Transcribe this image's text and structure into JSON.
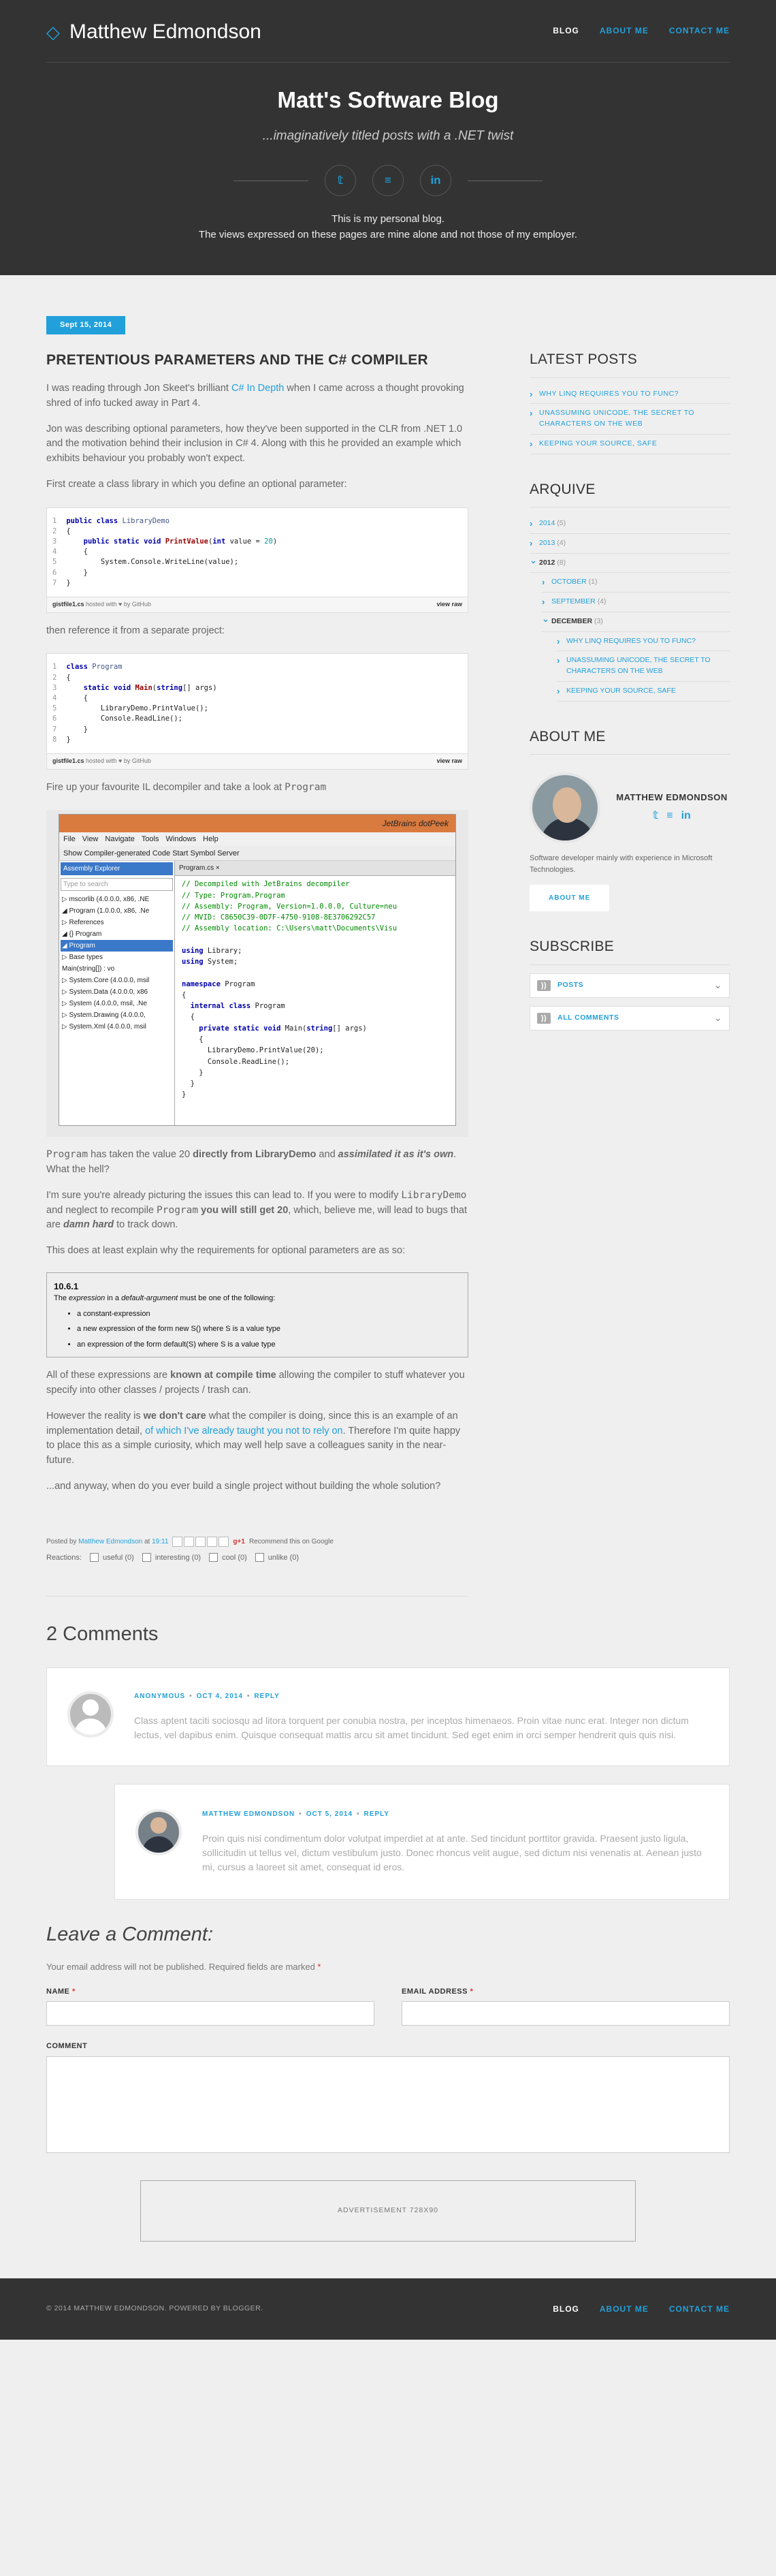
{
  "site": {
    "name": "Matthew Edmondson",
    "nav": [
      {
        "label": "BLOG",
        "active": true
      },
      {
        "label": "ABOUT ME",
        "active": false
      },
      {
        "label": "CONTACT ME",
        "active": false
      }
    ],
    "blog_title_prefix": "Matt's ",
    "blog_title_bold": "Software Blog",
    "tagline": "...imaginatively titled posts with a .NET twist",
    "socials": [
      "twitter",
      "stackoverflow",
      "linkedin"
    ],
    "note_line1": "This is my personal blog.",
    "note_line2": "The views expressed on these pages are mine alone and not those of my employer."
  },
  "post": {
    "date": "Sept 15, 2014",
    "title": "PRETENTIOUS PARAMETERS AND THE C# COMPILER",
    "p1_a": "I was reading through Jon Skeet's brilliant ",
    "p1_link": "C# In Depth",
    "p1_b": " when I came across a thought provoking shred of info tucked away in Part 4.",
    "p2": "Jon was describing optional parameters, how they've been supported in the CLR from .NET 1.0 and the motivation behind their inclusion in C# 4. Along with this he provided an example which exhibits behaviour you probably won't expect.",
    "p3": "First create a class library in which you define an optional parameter:",
    "gist1": {
      "lines": [
        "1",
        "2",
        "3",
        "4",
        "5",
        "6",
        "7"
      ],
      "file": "gistfile1.cs",
      "hosted": " hosted with ♥ by ",
      "host": "GitHub",
      "raw": "view raw"
    },
    "p4": "then reference it from a separate project:",
    "gist2": {
      "lines": [
        "1",
        "2",
        "3",
        "4",
        "5",
        "6",
        "7",
        "8"
      ],
      "file": "gistfile1.cs",
      "hosted": " hosted with ♥ by ",
      "host": "GitHub",
      "raw": "view raw"
    },
    "p5_a": "Fire up your favourite IL decompiler and take a look at ",
    "p5_code": "Program",
    "ide": {
      "title": "JetBrains dotPeek",
      "menu": [
        "File",
        "View",
        "Navigate",
        "Tools",
        "Windows",
        "Help"
      ],
      "toolbar": "Show Compiler-generated Code   Start Symbol Server",
      "tree_header": "Assembly Explorer",
      "tree_search": "Type to search",
      "tree": [
        "▷ mscorlib (4.0.0.0, x86, .NE",
        "◢ Program (1.0.0.0, x86, .Ne",
        "  ▷ References",
        "  ◢ {} Program",
        "    ◢ Program",
        "      ▷ Base types",
        "        Main(string[]) : vo",
        "▷ System.Core (4.0.0.0, msil",
        "▷ System.Data (4.0.0.0, x86",
        "▷ System (4.0.0.0, msil, .Ne",
        "▷ System.Drawing (4.0.0.0,",
        "▷ System.Xml (4.0.0.0, msil"
      ],
      "tab": "Program.cs ×",
      "code_comments": [
        "// Decompiled with JetBrains decompiler",
        "// Type: Program.Program",
        "// Assembly: Program, Version=1.0.0.0, Culture=neu",
        "// MVID: C8650C39-0D7F-4750-9108-8E3706292C57",
        "// Assembly location: C:\\Users\\matt\\Documents\\Visu"
      ]
    },
    "p6_code1": "Program",
    "p6_a": " has taken the value 20 ",
    "p6_b": "directly from LibraryDemo",
    "p6_c": " and ",
    "p6_d": "assimilated it as it's own",
    "p6_e": ". What the hell?",
    "p7_a": "I'm sure you're already picturing the issues this can lead to.  If you were to modify ",
    "p7_code1": "LibraryDemo",
    "p7_b": " and neglect to recompile ",
    "p7_code2": "Program",
    "p7_c": " you will still get 20",
    "p7_d": ", which, believe me, will lead to bugs that are ",
    "p7_e": "damn hard",
    "p7_f": " to track down.",
    "p8": "This does at least explain why the requirements for optional parameters are as so:",
    "spec": {
      "num": "10.6.1",
      "intro_a": "The ",
      "intro_b": "expression",
      "intro_c": " in a ",
      "intro_d": "default-argument",
      "intro_e": " must be one of the following:",
      "items": [
        "a constant-expression",
        "a new expression of the form new S() where S is a value type",
        "an expression of the form default(S) where S is a value type"
      ]
    },
    "p9_a": "All of these expressions are ",
    "p9_b": "known at compile time",
    "p9_c": " allowing the compiler to stuff whatever you specify into other classes / projects / trash can.",
    "p10_a": "However the reality is ",
    "p10_b": "we don't care",
    "p10_c": " what the compiler is doing, since this is an example of an implementation detail, ",
    "p10_link": "of which I've already taught you not to rely on",
    "p10_d": ". Therefore I'm quite happy to place this as a simple curiosity, which may well help save a colleagues sanity in the near-future.",
    "p11": "...and anyway, when do you ever build a single project without building the whole solution?",
    "meta_posted": "Posted by ",
    "meta_author": "Matthew Edmondson",
    "meta_at": " at ",
    "meta_time": "19:11",
    "meta_recommend": "Recommend this on Google",
    "meta_g1": "g+1",
    "reactions_label": "Reactions:",
    "reactions": [
      "useful (0)",
      "interesting (0)",
      "cool (0)",
      "unlike (0)"
    ]
  },
  "sidebar": {
    "latest_title": "LATEST POSTS",
    "latest": [
      "WHY LINQ REQUIRES YOU TO FUNC?",
      "UNASSUMING UNICODE, THE SECRET TO CHARACTERS ON THE WEB",
      "KEEPING YOUR SOURCE, SAFE"
    ],
    "archive_title": "ARQUIVE",
    "archive": {
      "y2014": "2014",
      "y2014c": "(5)",
      "y2013": "2013",
      "y2013c": "(4)",
      "y2012": "2012",
      "y2012c": "(8)",
      "oct": "OCTOBER",
      "octc": "(1)",
      "sep": "SEPTEMBER",
      "sepc": "(4)",
      "dec": "DECEMBER",
      "decc": "(3)",
      "posts": [
        "WHY LINQ REQUIRES YOU TO FUNC?",
        "UNASSUMING UNICODE, THE SECRET TO CHARACTERS ON THE WEB",
        "KEEPING YOUR SOURCE, SAFE"
      ]
    },
    "about_title": "ABOUT ME",
    "about_name": "MATTHEW EDMONDSON",
    "about_text": "Software developer mainly with experience in Microsoft Technologies.",
    "about_button": "ABOUT ME",
    "subscribe_title": "SUBSCRIBE",
    "subscribe": [
      "POSTS",
      "ALL COMMENTS"
    ]
  },
  "comments": {
    "title": "2 Comments",
    "items": [
      {
        "author": "ANONYMOUS",
        "date": "OCT 4, 2014",
        "reply": "REPLY",
        "text": "Class aptent taciti sociosqu ad litora torquent per conubia nostra, per inceptos himenaeos. Proin vitae nunc erat. Integer non dictum lectus, vel dapibus enim. Quisque consequat mattis arcu sit amet tincidunt. Sed eget enim in orci semper hendrerit quis quis nisi."
      },
      {
        "author": "MATTHEW EDMONDSON",
        "date": "OCT 5, 2014",
        "reply": "REPLY",
        "text": "Proin quis nisi condimentum dolor volutpat imperdiet at at ante. Sed tincidunt porttitor gravida. Praesent justo ligula, sollicitudin ut tellus vel, dictum vestibulum justo. Donec rhoncus velit augue, sed dictum nisi venenatis at. Aenean justo mi, cursus a laoreet sit amet, consequat id eros."
      }
    ]
  },
  "form": {
    "title": "Leave a Comment:",
    "note": "Your email address will not be published. Required fields are marked ",
    "star": "*",
    "name_label": "NAME",
    "email_label": "EMAIL ADDRESS",
    "comment_label": "COMMENT"
  },
  "ad": "ADVERTISEMENT 728X90",
  "footer": {
    "copy": "© 2014 MATTHEW EDMONDSON. POWERED BY BLOGGER.",
    "nav": [
      {
        "label": "BLOG",
        "active": true
      },
      {
        "label": "ABOUT ME",
        "active": false
      },
      {
        "label": "CONTACT ME",
        "active": false
      }
    ]
  }
}
